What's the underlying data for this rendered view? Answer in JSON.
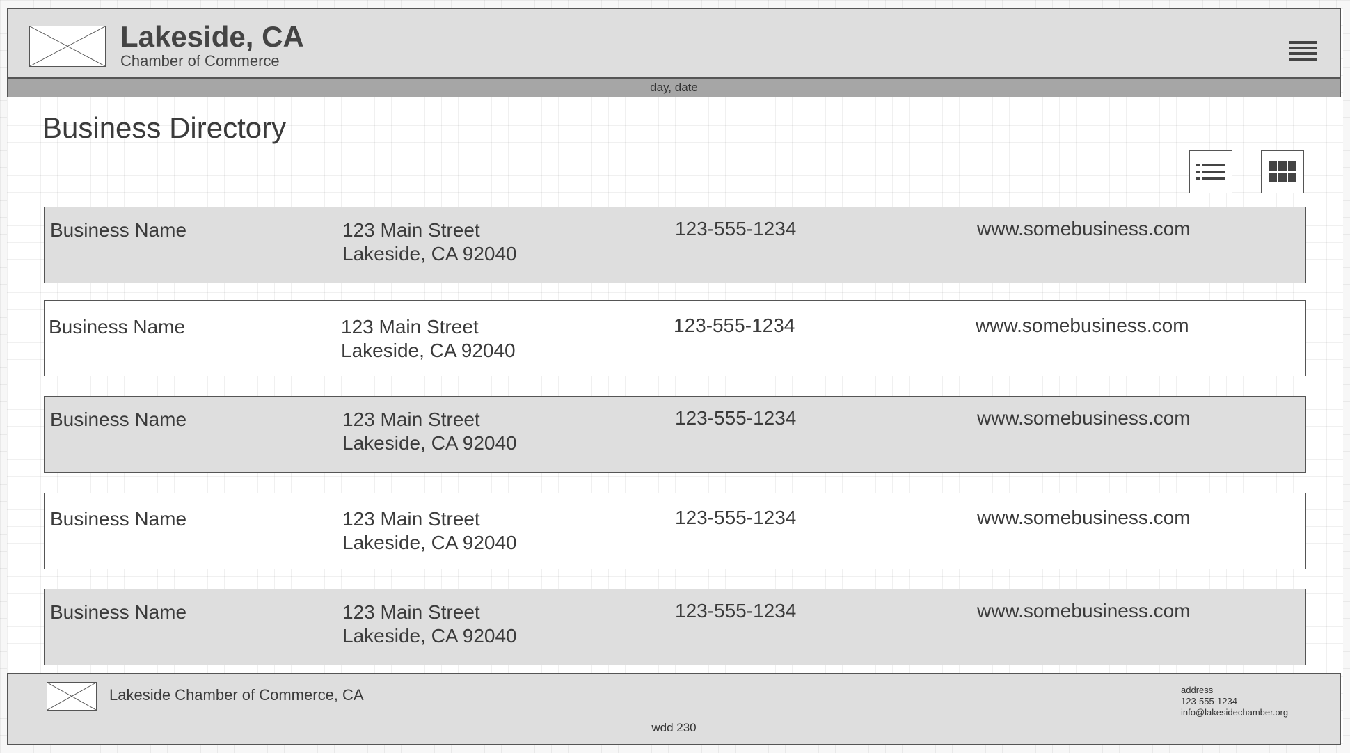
{
  "header": {
    "title": "Lakeside, CA",
    "subtitle": "Chamber of Commerce",
    "logo_icon": "image-placeholder-icon",
    "menu_icon": "hamburger-menu-icon"
  },
  "date_bar": {
    "text": "day, date"
  },
  "page": {
    "title": "Business Directory"
  },
  "view_toggle": {
    "list_icon": "list-view-icon",
    "grid_icon": "grid-view-icon"
  },
  "businesses": [
    {
      "name": "Business Name",
      "street": "123 Main Street",
      "city": "Lakeside, CA 92040",
      "phone": "123-555-1234",
      "website": "www.somebusiness.com"
    },
    {
      "name": "Business Name",
      "street": "123 Main Street",
      "city": "Lakeside, CA 92040",
      "phone": "123-555-1234",
      "website": "www.somebusiness.com"
    },
    {
      "name": "Business Name",
      "street": "123 Main Street",
      "city": "Lakeside, CA 92040",
      "phone": "123-555-1234",
      "website": "www.somebusiness.com"
    },
    {
      "name": "Business Name",
      "street": "123 Main Street",
      "city": "Lakeside, CA 92040",
      "phone": "123-555-1234",
      "website": "www.somebusiness.com"
    },
    {
      "name": "Business Name",
      "street": "123 Main Street",
      "city": "Lakeside, CA 92040",
      "phone": "123-555-1234",
      "website": "www.somebusiness.com"
    }
  ],
  "footer": {
    "name": "Lakeside Chamber of Commerce, CA",
    "code": "wdd 230",
    "address": "address",
    "phone": "123-555-1234",
    "email": "info@lakesidechamber.org"
  },
  "colors": {
    "header_bg": "#dedede",
    "date_bar_bg": "#a6a6a6",
    "row_shaded_bg": "#dedede",
    "row_plain_bg": "#ffffff",
    "text": "#3b3b3b",
    "border": "#555555"
  }
}
